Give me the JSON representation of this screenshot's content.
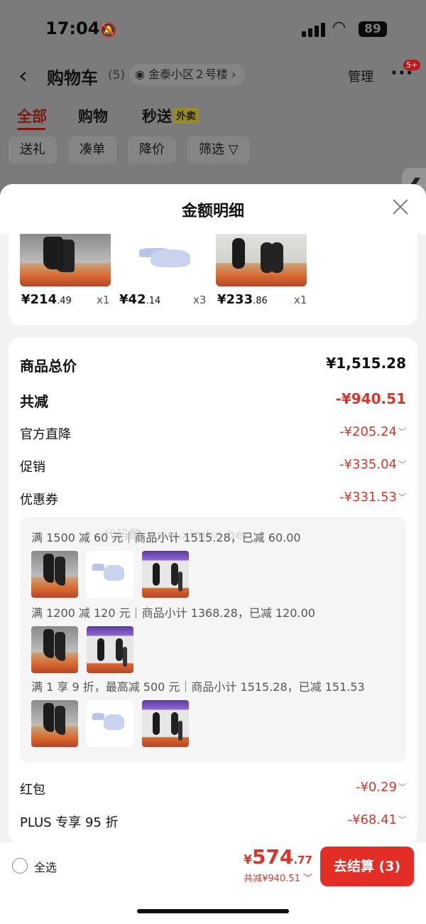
{
  "status_bar": {
    "time": "17:04",
    "battery": "89"
  },
  "cart_header": {
    "title": "购物车",
    "count": "(5)",
    "address": "金泰小区２号楼",
    "manage": "管理",
    "badge": "5+"
  },
  "tabs": [
    {
      "label": "全部",
      "active": true
    },
    {
      "label": "购物"
    },
    {
      "label": "秒送",
      "tag": "外卖"
    }
  ],
  "chips": [
    "送礼",
    "凑单",
    "降价",
    "筛选"
  ],
  "sheet": {
    "title": "金额明细"
  },
  "products": [
    {
      "price_main": "¥214",
      "price_dec": ".49",
      "qty": "x1"
    },
    {
      "price_main": "¥42",
      "price_dec": ".14",
      "qty": "x3"
    },
    {
      "price_main": "¥233",
      "price_dec": ".86",
      "qty": "x1"
    }
  ],
  "breakdown": {
    "total_label": "商品总价",
    "total_value": "¥1,515.28",
    "discount_label": "共减",
    "discount_value": "-¥940.51",
    "official_label": "官方直降",
    "official_value": "-¥205.24",
    "promo_label": "促销",
    "promo_value": "-¥335.04",
    "coupon_label": "优惠券",
    "coupon_value": "-¥331.53",
    "redpacket_label": "红包",
    "redpacket_value": "-¥0.29",
    "plus_label": "PLUS 专享 95 折",
    "plus_value": "-¥68.41"
  },
  "coupons": [
    {
      "text": "满 1500 减 60 元｜商品小计 1515.28，已减 60.00"
    },
    {
      "text": "满 1200 减 120 元｜商品小计 1368.28，已减 120.00"
    },
    {
      "text": "满 1 享 9 折，最高减 500 元｜商品小计 1515.28，已减 151.53"
    }
  ],
  "watermark": "代码酷 www.ximbn.ber",
  "bottom": {
    "select_all": "全选",
    "price_yen": "¥",
    "price_main": "574",
    "price_dec": ".77",
    "discount": "共减¥940.51",
    "checkout": "去结算 (3)"
  }
}
